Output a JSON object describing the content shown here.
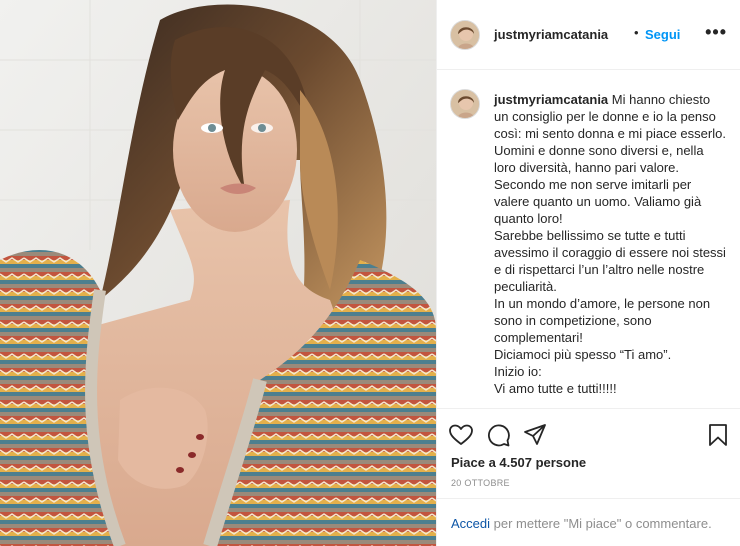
{
  "post": {
    "username": "justmyriamcatania",
    "separator": "•",
    "follow_label": "Segui",
    "more_label": "•••",
    "caption_lines": [
      "Mi hanno chiesto un consiglio per le donne e io la penso così: mi sento donna e mi piace esserlo.",
      "Uomini e donne sono diversi e, nella loro diversità, hanno pari valore.",
      "Secondo me non serve imitarli per valere quanto un uomo. Valiamo già quanto loro!",
      "Sarebbe bellissimo se tutte e tutti avessimo il coraggio di essere noi stessi e di rispettarci l’un l’altro nelle nostre peculiarità.",
      "In un mondo d’amore, le persone non sono in competizione, sono complementari!",
      "Diciamoci più spesso “Ti amo”.",
      "Inizio io:",
      "Vi amo tutte e tutti!!!!!"
    ],
    "likes_text": "Piace a 4.507 persone",
    "date_text": "20 OTTOBRE",
    "footer": {
      "login_label": "Accedi",
      "rest_text": " per mettere \"Mi piace\" o commentare."
    },
    "icons": {
      "avatar": "profile-avatar",
      "like": "heart-icon",
      "comment": "comment-icon",
      "share": "share-icon",
      "save": "bookmark-icon"
    },
    "colors": {
      "link": "#0095f6",
      "text": "#262626",
      "muted": "#8e8e8e"
    }
  }
}
